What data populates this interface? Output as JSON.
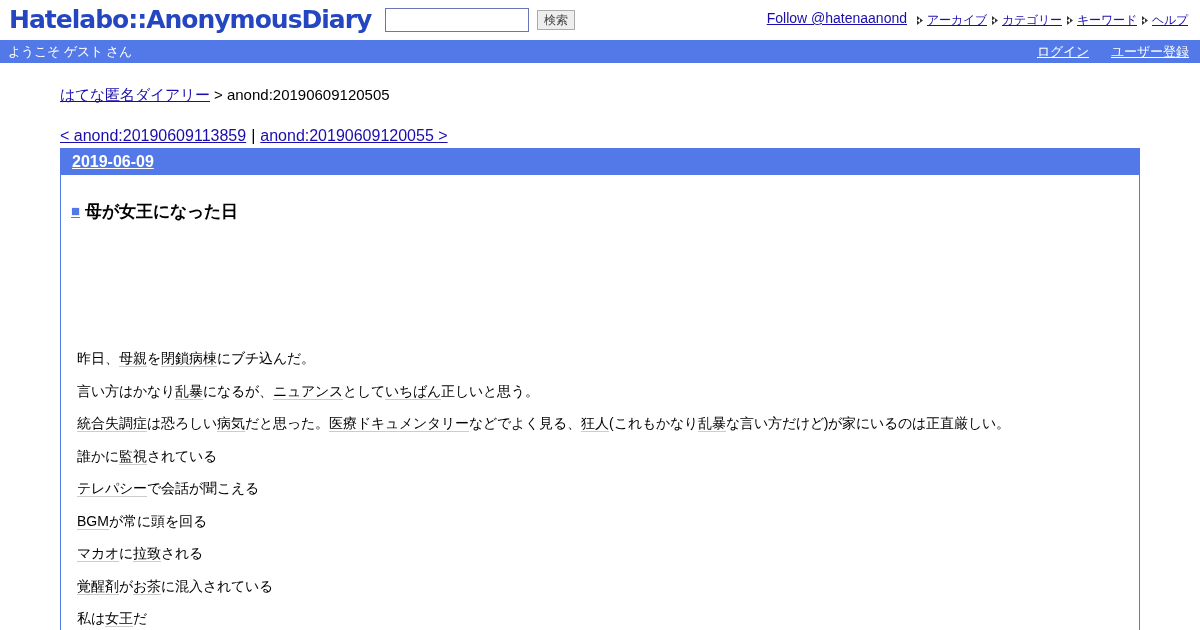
{
  "header": {
    "logo": "Hatelabo::AnonymousDiary",
    "search": {
      "button": "検索"
    },
    "follow": "Follow @hatenaanond",
    "links": [
      "アーカイブ",
      "カテゴリー",
      "キーワード",
      "ヘルプ"
    ]
  },
  "userbar": {
    "welcome": "ようこそ ゲスト さん",
    "links": [
      "ログイン",
      "ユーザー登録"
    ]
  },
  "breadcrumb": {
    "link": "はてな匿名ダイアリー",
    "current": "> anond:20190609120505"
  },
  "pager": {
    "prev": "< anond:20190609113859",
    "separator": "|",
    "next": "anond:20190609120055 >"
  },
  "day": {
    "date": "2019-06-09",
    "title_mark": "■",
    "title": "母が女王になった日",
    "paragraphs": [
      [
        {
          "text": "昨日、",
          "keyword": false
        },
        {
          "text": "母親",
          "keyword": true
        },
        {
          "text": "を",
          "keyword": false
        },
        {
          "text": "閉鎖病棟",
          "keyword": true
        },
        {
          "text": "にブチ込んだ。",
          "keyword": false
        }
      ],
      [
        {
          "text": "言い方はかなり",
          "keyword": false
        },
        {
          "text": "乱暴",
          "keyword": true
        },
        {
          "text": "になるが、",
          "keyword": false
        },
        {
          "text": "ニュアンス",
          "keyword": true
        },
        {
          "text": "として",
          "keyword": false
        },
        {
          "text": "いちばん",
          "keyword": true
        },
        {
          "text": "正しいと思う。",
          "keyword": false
        }
      ],
      [
        {
          "text": "統合失調症",
          "keyword": true
        },
        {
          "text": "は恐ろしい",
          "keyword": false
        },
        {
          "text": "病気",
          "keyword": true
        },
        {
          "text": "だと思った。",
          "keyword": false
        },
        {
          "text": "医療ドキュメンタリー",
          "keyword": true
        },
        {
          "text": "などでよく見る、",
          "keyword": false
        },
        {
          "text": "狂人",
          "keyword": true
        },
        {
          "text": "(これもかなり",
          "keyword": false
        },
        {
          "text": "乱暴",
          "keyword": true
        },
        {
          "text": "な言い方だけど)が家にいるのは正直厳しい。",
          "keyword": false
        }
      ],
      [
        {
          "text": "誰かに",
          "keyword": false
        },
        {
          "text": "監視",
          "keyword": true
        },
        {
          "text": "されている",
          "keyword": false
        }
      ],
      [
        {
          "text": "テレパシー",
          "keyword": true
        },
        {
          "text": "で会話が聞こえる",
          "keyword": false
        }
      ],
      [
        {
          "text": "BGM",
          "keyword": true
        },
        {
          "text": "が常に頭を回る",
          "keyword": false
        }
      ],
      [
        {
          "text": "マカオ",
          "keyword": true
        },
        {
          "text": "に",
          "keyword": false
        },
        {
          "text": "拉致",
          "keyword": true
        },
        {
          "text": "される",
          "keyword": false
        }
      ],
      [
        {
          "text": "覚醒剤",
          "keyword": true
        },
        {
          "text": "が",
          "keyword": false
        },
        {
          "text": "お茶",
          "keyword": true
        },
        {
          "text": "に混入されている",
          "keyword": false
        }
      ],
      [
        {
          "text": "私は",
          "keyword": false
        },
        {
          "text": "女王",
          "keyword": true
        },
        {
          "text": "だ",
          "keyword": false
        }
      ]
    ]
  }
}
